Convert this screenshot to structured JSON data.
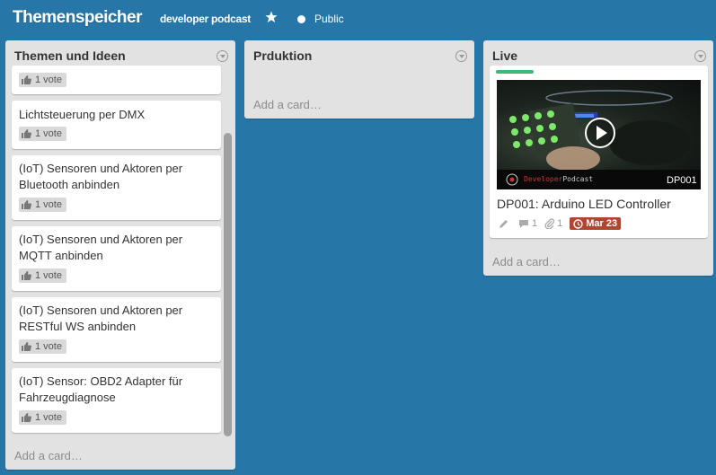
{
  "header": {
    "board_title": "Themenspeicher",
    "org_name": "developer podcast",
    "visibility": "Public"
  },
  "lists": [
    {
      "title": "Themen und Ideen",
      "add_card": "Add a card…",
      "cards": [
        {
          "title": "",
          "votes": "1 vote"
        },
        {
          "title": "Lichtsteuerung per DMX",
          "votes": "1 vote"
        },
        {
          "title_lines": [
            "(IoT) Sensoren und Aktoren per",
            "Bluetooth anbinden"
          ],
          "votes": "1 vote"
        },
        {
          "title_lines": [
            "(IoT) Sensoren und Aktoren per",
            "MQTT anbinden"
          ],
          "votes": "1 vote"
        },
        {
          "title_lines": [
            "(IoT) Sensoren und Aktoren per",
            "RESTful WS anbinden"
          ],
          "votes": "1 vote"
        },
        {
          "title_lines": [
            "(IoT) Sensor: OBD2 Adapter für",
            "Fahrzeugdiagnose"
          ],
          "votes": "1 vote"
        }
      ]
    },
    {
      "title": "Prduktion",
      "add_card": "Add a card…"
    },
    {
      "title": "Live",
      "add_card": "Add a card…",
      "cards": [
        {
          "title": "DP001: Arduino LED Controller",
          "label_color": "#3cb878",
          "thumbnail": {
            "logo_red": "Developer",
            "logo_grey": "Podcast",
            "code": "DP001"
          },
          "comments": "1",
          "attachments": "1",
          "due": "Mar 23",
          "due_color": "#b04632"
        }
      ]
    }
  ],
  "colors": {
    "board_bg": "#2676a8",
    "list_bg": "#e2e2e2"
  }
}
